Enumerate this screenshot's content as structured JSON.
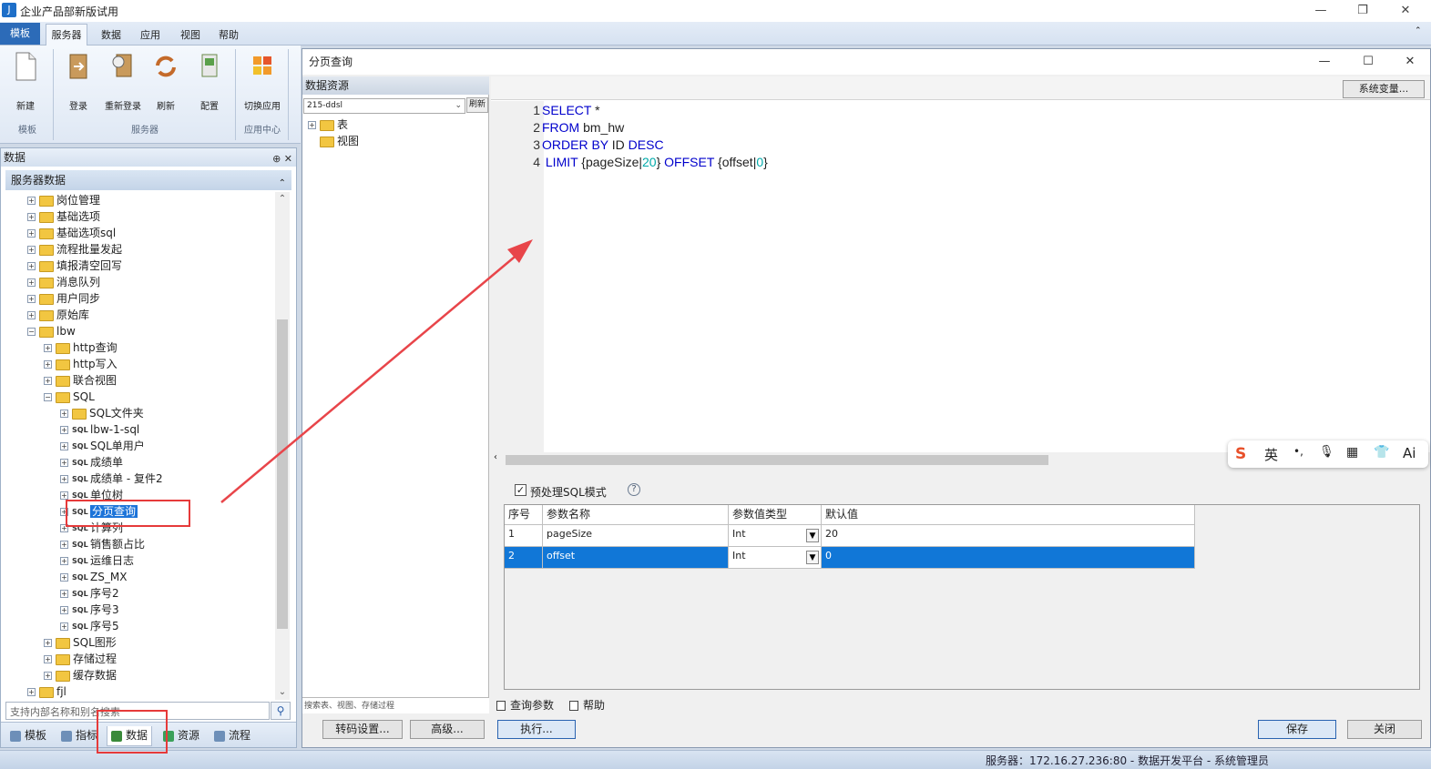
{
  "window": {
    "title": "企业产品部新版试用",
    "minimize": "—",
    "restore": "❐",
    "close": "✕"
  },
  "menu": {
    "template_button": "模板",
    "items": [
      "服务器",
      "数据",
      "应用",
      "视图",
      "帮助"
    ]
  },
  "ribbon": {
    "buttons": [
      "新建",
      "登录",
      "重新登录",
      "刷新",
      "配置",
      "切换应用"
    ],
    "groups": [
      "模板",
      "服务器",
      "应用中心"
    ]
  },
  "left_panel": {
    "title": "数据",
    "header_buttons": "⊕ ✕",
    "section": "服务器数据",
    "tree": [
      {
        "label": "岗位管理",
        "type": "folder",
        "level": 1
      },
      {
        "label": "基础选项",
        "type": "folder",
        "level": 1
      },
      {
        "label": "基础选项sql",
        "type": "folder",
        "level": 1
      },
      {
        "label": "流程批量发起",
        "type": "folder",
        "level": 1
      },
      {
        "label": "填报清空回写",
        "type": "folder",
        "level": 1
      },
      {
        "label": "消息队列",
        "type": "folder",
        "level": 1
      },
      {
        "label": "用户同步",
        "type": "folder",
        "level": 1
      },
      {
        "label": "原始库",
        "type": "folder",
        "level": 1
      },
      {
        "label": "lbw",
        "type": "folder",
        "level": 1,
        "expanded": true
      },
      {
        "label": "http查询",
        "type": "folder",
        "level": 2
      },
      {
        "label": "http写入",
        "type": "folder",
        "level": 2
      },
      {
        "label": "联合视图",
        "type": "folder",
        "level": 2
      },
      {
        "label": "SQL",
        "type": "folder",
        "level": 2,
        "expanded": true
      },
      {
        "label": "SQL文件夹",
        "type": "folder",
        "level": 3
      },
      {
        "label": "lbw-1-sql",
        "type": "sql",
        "level": 3
      },
      {
        "label": "SQL单用户",
        "type": "sql",
        "level": 3
      },
      {
        "label": "成绩单",
        "type": "sql",
        "level": 3
      },
      {
        "label": "成绩单 - 复件2",
        "type": "sql",
        "level": 3
      },
      {
        "label": "单位树",
        "type": "sql",
        "level": 3
      },
      {
        "label": "分页查询",
        "type": "sql",
        "level": 3,
        "selected": true
      },
      {
        "label": "计算列",
        "type": "sql",
        "level": 3
      },
      {
        "label": "销售额占比",
        "type": "sql",
        "level": 3
      },
      {
        "label": "运维日志",
        "type": "sql",
        "level": 3
      },
      {
        "label": "ZS_MX",
        "type": "sql",
        "level": 3
      },
      {
        "label": "序号2",
        "type": "sql",
        "level": 3
      },
      {
        "label": "序号3",
        "type": "sql",
        "level": 3
      },
      {
        "label": "序号5",
        "type": "sql",
        "level": 3
      },
      {
        "label": "SQL图形",
        "type": "folder",
        "level": 2
      },
      {
        "label": "存储过程",
        "type": "folder",
        "level": 2
      },
      {
        "label": "缓存数据",
        "type": "folder",
        "level": 2
      },
      {
        "label": "fjl",
        "type": "folder",
        "level": 1
      }
    ],
    "search_placeholder": "支持内部名称和别名搜索",
    "tabs": [
      "模板",
      "指标",
      "数据",
      "资源",
      "流程"
    ],
    "active_tab": "数据"
  },
  "dialog": {
    "title": "分页查询",
    "data_source": {
      "header": "数据资源",
      "selected": "215-ddsl",
      "refresh_button": "刷新",
      "tree": [
        "表",
        "视图"
      ],
      "filter_placeholder": "搜索表、视图、存储过程"
    },
    "system_variables_button": "系统变量...",
    "sql_lines": [
      {
        "num": "1",
        "text": "SELECT *"
      },
      {
        "num": "2",
        "text": "FROM bm_hw"
      },
      {
        "num": "3",
        "text": "ORDER BY ID DESC"
      },
      {
        "num": "4",
        "text": " LIMIT {pageSize|20} OFFSET {offset|0}"
      }
    ],
    "preprocess_label": "预处理SQL模式",
    "preprocess_checked": true,
    "params_columns": [
      "序号",
      "参数名称",
      "参数值类型",
      "默认值"
    ],
    "params_rows": [
      {
        "index": "1",
        "name": "pageSize",
        "type": "Int",
        "default": "20"
      },
      {
        "index": "2",
        "name": "offset",
        "type": "Int",
        "default": "0"
      }
    ],
    "bottom_tabs": [
      "查询参数",
      "帮助"
    ],
    "buttons": {
      "encoding": "转码设置...",
      "advanced": "高级...",
      "execute": "执行...",
      "save": "保存",
      "close": "关闭"
    }
  },
  "ime": {
    "logo": "S",
    "lang": "英",
    "items": [
      "•,",
      "🎙",
      "▦",
      "👕",
      "Ai"
    ]
  },
  "status": "服务器：172.16.27.236:80 - 数据开发平台 - 系统管理员"
}
